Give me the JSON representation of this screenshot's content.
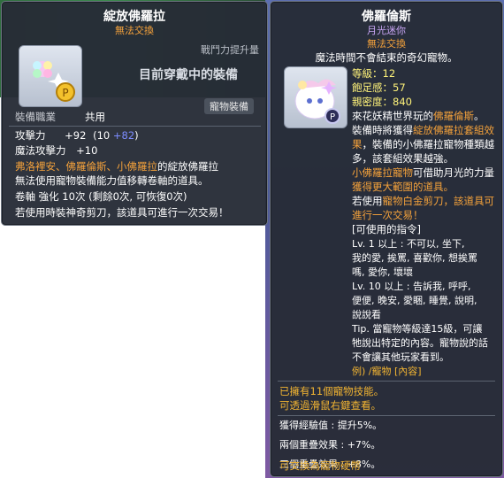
{
  "left_tooltip": {
    "title": "綻放佛羅拉",
    "untradeable": "無法交換",
    "power_label": "戰鬥力提升量",
    "equipped_text": "目前穿戴中的裝備",
    "category_tag": "寵物裝備",
    "job_label": "裝備職業",
    "job_value": "共用",
    "attack_label": "攻擊力",
    "attack_value": "+92",
    "attack_base": "(10",
    "attack_bonus": "+82",
    "attack_close": ")",
    "mattack_label": "魔法攻擊力",
    "mattack_value": "+10",
    "desc_pets": "弗洛裡安、佛羅倫斯、小佛羅拉",
    "desc_rest": "的綻放佛羅拉",
    "desc_line2": "無法使用寵物裝備能力值移轉卷軸的道具。",
    "scroll_line": "卷軸 強化 10次 (剩餘0次, 可恢復0次)",
    "scissors_line": "若使用時裝神奇剪刀，該道具可進行一次交易！"
  },
  "right_tooltip": {
    "title": "佛羅倫斯",
    "subtitle": "月光迷你",
    "untradeable": "無法交換",
    "magic_time": "魔法時間不會結束的奇幻寵物。",
    "level": "等級：12",
    "fullness": "飽足感：57",
    "closeness": "親密度：840",
    "desc1": "來花妖精世界玩的",
    "desc1_name": "佛羅倫斯",
    "desc1_end": "。",
    "desc2_a": "裝備時將獲得",
    "desc2_b": "綻放佛羅拉套組效",
    "desc3_a": "果",
    "desc3_b": "，裝備的小佛羅拉寵物種類越",
    "desc4": "多，該套組效果越強。",
    "desc5_a": "小佛羅拉寵物",
    "desc5_b": "可借助月光的力量",
    "desc6": "獲得更大範圍的道具。",
    "desc7_a": "若使用",
    "desc7_b": "寵物白金剪刀，該道具可",
    "desc8": "進行一次交易！",
    "commands_header": "[可使用的指令]",
    "cmd1": "Lv. 1 以上 : 不可以, 坐下,",
    "cmd2": "我的愛, 挨罵, 喜歡你, 想挨罵",
    "cmd3": "嗎, 愛你, 壞壞",
    "cmd4": "Lv. 10 以上 : 告訴我, 呼呼,",
    "cmd5": "便便, 晚安, 愛睏, 睡覺, 說明,",
    "cmd6": "說說看",
    "tip1": "Tip. 當寵物等級達15級，可讓",
    "tip2": "牠說出特定的內容。寵物說的話",
    "tip3": "不會讓其他玩家看到。",
    "example": "例) /寵物 [內容]",
    "skills1": "已擁有11個寵物技能。",
    "skills2": "可透過滑鼠右鍵查看。",
    "exp_label": "獲得經驗值 : 提升5%。",
    "double_label": "兩個重疊效果 : +7%。",
    "triple_label": "三個重疊效果 : +8%。",
    "exchange": "可交換為寵物硬幣"
  }
}
